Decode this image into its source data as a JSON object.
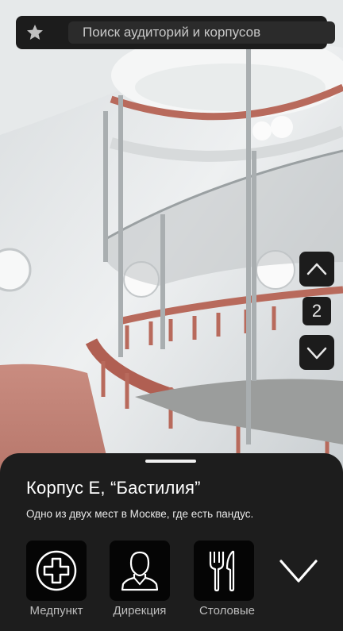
{
  "search": {
    "placeholder": "Поиск аудиторий и корпусов",
    "favorites_icon": "star-icon"
  },
  "floor_controls": {
    "current_floor": "2",
    "up_icon": "chevron-up-icon",
    "down_icon": "chevron-down-icon"
  },
  "building_card": {
    "title": "Корпус Е, “Бастилия”",
    "description": "Одно из двух мест в Москве, где есть пандус.",
    "actions": [
      {
        "label": "Медпункт",
        "icon": "medical-cross-icon"
      },
      {
        "label": "Дирекция",
        "icon": "person-icon"
      },
      {
        "label": "Столовые",
        "icon": "cutlery-icon"
      }
    ],
    "expand_icon": "chevron-down-icon"
  },
  "colors": {
    "panel": "#1d1d1d",
    "button": "#050505",
    "text": "#ffffff",
    "muted_text": "#bdbdbd"
  }
}
